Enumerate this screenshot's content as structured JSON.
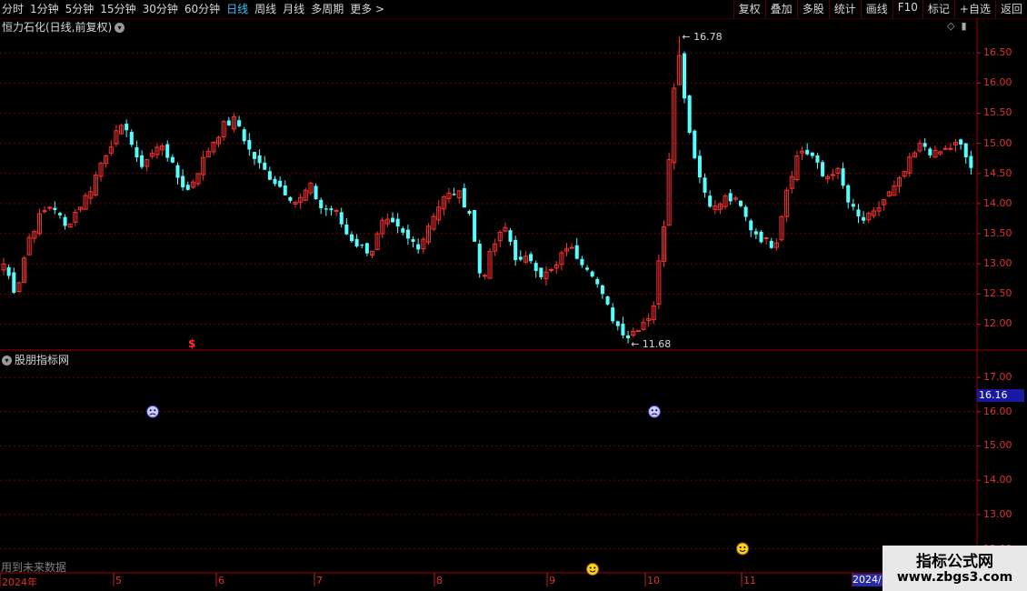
{
  "toolbar": {
    "periods": [
      "分时",
      "1分钟",
      "5分钟",
      "15分钟",
      "30分钟",
      "60分钟",
      "日线",
      "周线",
      "月线",
      "多周期",
      "更多 >"
    ],
    "active": "日线",
    "right_buttons": [
      "复权",
      "叠加",
      "多股",
      "统计",
      "画线",
      "F10",
      "标记",
      "+自选",
      "返回"
    ]
  },
  "main": {
    "title": "恒力石化(日线,前复权)",
    "high_label": "16.78",
    "low_label": "11.68",
    "signal_glyph": "$"
  },
  "indicator": {
    "title": "股朋指标网",
    "price_tag": "16.16",
    "future_text": "用到未来数据"
  },
  "chart_data": [
    {
      "type": "candlestick",
      "title": "恒力石化(日线,前复权)",
      "y_ticks": [
        16.5,
        16.0,
        15.5,
        15.0,
        14.5,
        14.0,
        13.5,
        13.0,
        12.5,
        12.0
      ],
      "ylim": [
        11.6,
        16.85
      ],
      "annotations": [
        {
          "label": "16.78",
          "value": 16.78
        },
        {
          "label": "11.68",
          "value": 11.68
        }
      ],
      "colors": {
        "up": "#ff3030",
        "down": "#54ffff",
        "grid": "#7a0000"
      },
      "close_path": [
        13.0,
        12.5,
        13.4,
        13.8,
        14.0,
        13.6,
        13.9,
        14.2,
        14.7,
        15.1,
        15.3,
        14.6,
        14.8,
        15.0,
        14.5,
        14.2,
        14.6,
        15.0,
        15.3,
        15.4,
        14.9,
        14.6,
        14.4,
        14.2,
        14.0,
        14.3,
        13.9,
        13.9,
        13.5,
        13.3,
        13.2,
        13.7,
        13.6,
        13.4,
        13.3,
        13.8,
        14.1,
        14.2,
        13.9,
        12.7,
        13.3,
        13.6,
        13.0,
        13.1,
        12.8,
        12.9,
        13.3,
        13.1,
        12.9,
        12.4,
        12.0,
        11.8,
        12.0,
        12.2,
        13.8,
        16.7,
        15.2,
        14.3,
        13.9,
        14.1,
        14.0,
        13.6,
        13.4,
        13.3,
        14.3,
        14.9,
        14.8,
        14.4,
        14.6,
        14.0,
        13.7,
        13.8,
        14.1,
        14.3,
        14.7,
        15.0,
        14.8,
        14.9,
        15.0,
        14.6
      ],
      "candle_count": 190
    },
    {
      "type": "scatter",
      "title": "股朋指标网",
      "y_ticks": [
        17.0,
        16.0,
        15.0,
        14.0,
        13.0,
        12.0
      ],
      "ylim": [
        11.35,
        17.4
      ],
      "current_value": 16.16,
      "x_ticks": [
        "2024年",
        "5",
        "6",
        "7",
        "8",
        "9",
        "10",
        "11",
        "2024/"
      ],
      "points": [
        {
          "x": "5",
          "y": 16.0,
          "icon": "sad-face-icon"
        },
        {
          "x": "10",
          "y": 16.0,
          "icon": "sad-face-icon"
        },
        {
          "x": "11",
          "y": 12.0,
          "icon": "smile-face-icon"
        },
        {
          "x": "9",
          "y": 11.4,
          "icon": "smile-face-icon"
        }
      ]
    }
  ],
  "watermark": {
    "line1": "指标公式网",
    "line2": "www.zbgs3.com"
  }
}
